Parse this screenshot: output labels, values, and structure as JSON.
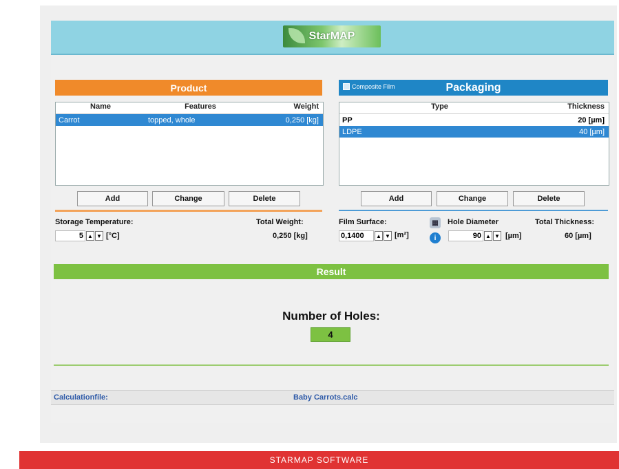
{
  "header": {
    "logo_text": "StarMAP"
  },
  "product": {
    "title": "Product",
    "columns": [
      "Name",
      "Features",
      "Weight"
    ],
    "rows": [
      {
        "name": "Carrot",
        "features": "topped, whole",
        "weight": "0,250 [kg]"
      }
    ],
    "buttons": {
      "add": "Add",
      "change": "Change",
      "delete": "Delete"
    },
    "storage_label": "Storage Temperature:",
    "storage_value": "5",
    "storage_unit": "[°C]",
    "total_weight_label": "Total Weight:",
    "total_weight_value": "0,250  [kg]"
  },
  "packaging": {
    "title": "Packaging",
    "composite_label": "Composite Film",
    "columns": [
      "Type",
      "Thickness"
    ],
    "rows": [
      {
        "type": "PP",
        "thickness": "20 [µm]"
      },
      {
        "type": "LDPE",
        "thickness": "40 [µm]"
      }
    ],
    "buttons": {
      "add": "Add",
      "change": "Change",
      "delete": "Delete"
    },
    "film_surface_label": "Film Surface:",
    "film_surface_value": "0,1400",
    "film_surface_unit": "[m²]",
    "hole_diameter_label": "Hole Diameter",
    "hole_diameter_value": "90",
    "hole_diameter_unit": "[µm]",
    "total_thickness_label": "Total Thickness:",
    "total_thickness_value": "60  [µm]"
  },
  "result": {
    "title": "Result",
    "holes_label": "Number of Holes:",
    "holes_value": "4"
  },
  "calc": {
    "label": "Calculationfile:",
    "file": "Baby Carrots.calc"
  },
  "footer": {
    "text": "STARMAP SOFTWARE"
  },
  "colors": {
    "orange": "#f08a2a",
    "blue": "#1f86c6",
    "green": "#7dc142",
    "red": "#e03333",
    "header": "#8fd3e3"
  }
}
